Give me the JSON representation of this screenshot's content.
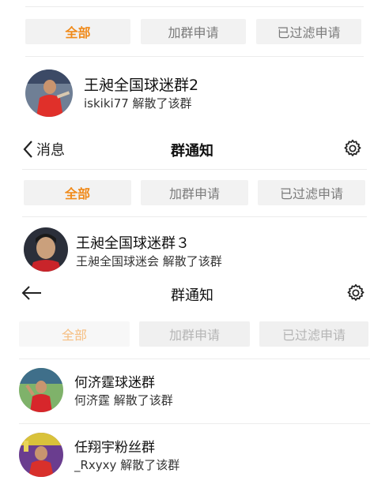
{
  "section1": {
    "tabs": [
      "全部",
      "加群申请",
      "已过滤申请"
    ],
    "group": {
      "name": "王昶全国球迷群2",
      "message": "iskiki77 解散了该群"
    }
  },
  "section2": {
    "nav": {
      "back_label": "消息",
      "title": "群通知"
    },
    "tabs": [
      "全部",
      "加群申请",
      "已过滤申请"
    ],
    "group": {
      "name": "王昶全国球迷群３",
      "message": "王昶全国球迷会 解散了该群"
    }
  },
  "section3": {
    "nav": {
      "title": "群通知"
    },
    "tabs": [
      "全部",
      "加群申请",
      "已过滤申请"
    ],
    "groups": [
      {
        "name": "何济霆球迷群",
        "message": "何济霆 解散了该群"
      },
      {
        "name": "任翔宇粉丝群",
        "message": "_Rxyxy 解散了该群"
      }
    ]
  },
  "colors": {
    "accent": "#f08a1a",
    "tab_bg": "#f2f2f2"
  }
}
